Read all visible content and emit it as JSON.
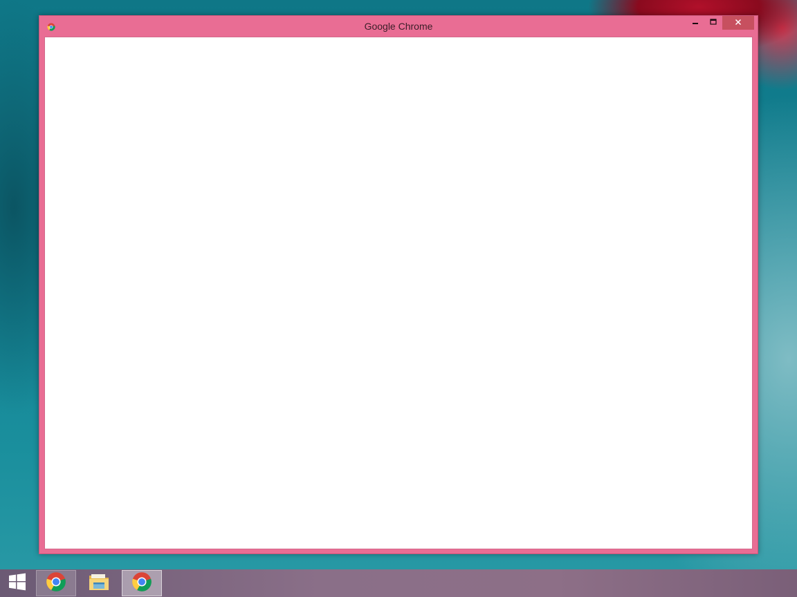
{
  "window": {
    "title": "Google Chrome",
    "frame_color": "#e96d94",
    "close_button_color": "#c7505f",
    "app_icon": "chrome-icon",
    "controls": {
      "minimize_icon": "minimize-icon",
      "maximize_icon": "maximize-icon",
      "close_icon": "close-icon"
    }
  },
  "taskbar": {
    "start_icon": "windows-logo-icon",
    "items": [
      {
        "icon": "chrome-icon",
        "state": "open"
      },
      {
        "icon": "file-explorer-icon",
        "state": "pinned"
      },
      {
        "icon": "chrome-icon",
        "state": "active"
      }
    ]
  }
}
